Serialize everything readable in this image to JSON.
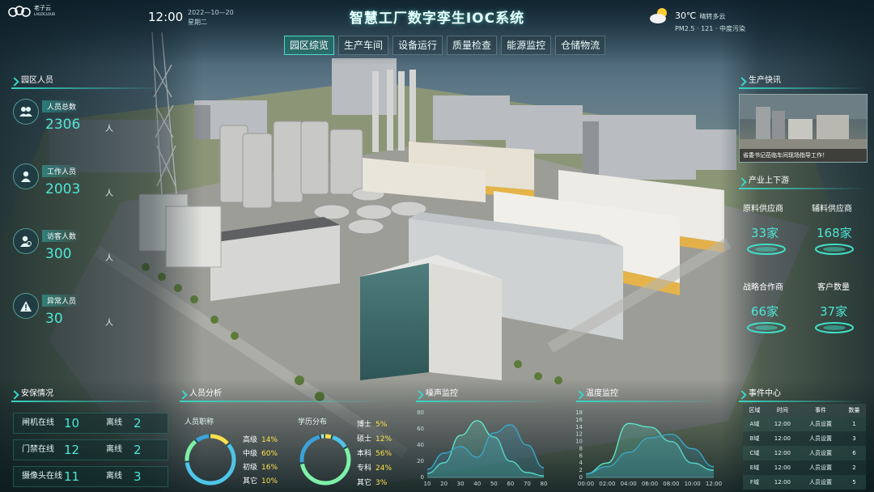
{
  "header": {
    "logo_text": "老子云",
    "logo_sub": "LAOZICLOUD",
    "time": "12:00",
    "date": "2022—10—20",
    "weekday": "星期二",
    "title": "智慧工厂数字孪生IOC系统",
    "weather": {
      "temp": "30℃",
      "desc": "晴转多云",
      "air": "PM2.5 · 121 · 中度污染",
      "icon": "partly-cloudy-icon"
    }
  },
  "nav": {
    "tabs": [
      "园区综览",
      "生产车间",
      "设备运行",
      "质量检查",
      "能源监控",
      "仓储物流"
    ],
    "active": 0
  },
  "personnel": {
    "title": "园区人员",
    "items": [
      {
        "label": "人员总数",
        "value": "2306",
        "unit": "人",
        "icon": "group-icon"
      },
      {
        "label": "工作人员",
        "value": "2003",
        "unit": "人",
        "icon": "worker-icon"
      },
      {
        "label": "访客人数",
        "value": "300",
        "unit": "人",
        "icon": "visitor-icon"
      },
      {
        "label": "异常人员",
        "value": "30",
        "unit": "人",
        "icon": "warning-icon"
      }
    ]
  },
  "security": {
    "title": "安保情况",
    "rows": [
      {
        "online_label": "闸机在线",
        "online": "10",
        "offline_label": "离线",
        "offline": "2"
      },
      {
        "online_label": "门禁在线",
        "online": "12",
        "offline_label": "离线",
        "offline": "2"
      },
      {
        "online_label": "摄像头在线",
        "online": "11",
        "offline_label": "离线",
        "offline": "3"
      }
    ]
  },
  "analysis": {
    "title": "人员分析",
    "rank_title": "人员职称",
    "rank": [
      {
        "name": "高级",
        "pct": "14%"
      },
      {
        "name": "中级",
        "pct": "60%"
      },
      {
        "name": "初级",
        "pct": "16%"
      },
      {
        "name": "其它",
        "pct": "10%"
      }
    ],
    "edu_title": "学历分布",
    "edu": [
      {
        "name": "博士",
        "pct": "5%"
      },
      {
        "name": "硕士",
        "pct": "12%"
      },
      {
        "name": "本科",
        "pct": "56%"
      },
      {
        "name": "专科",
        "pct": "24%"
      },
      {
        "name": "其它",
        "pct": "3%"
      }
    ]
  },
  "noise": {
    "title": "噪声监控",
    "chart_data": {
      "type": "area",
      "x": [
        10,
        20,
        30,
        40,
        50,
        60,
        70,
        80
      ],
      "ylim": [
        0,
        80
      ],
      "yticks": [
        0,
        20,
        40,
        60,
        80
      ],
      "series": [
        {
          "values": [
            5,
            18,
            52,
            70,
            50,
            20,
            6,
            2
          ]
        },
        {
          "values": [
            10,
            30,
            38,
            25,
            55,
            65,
            40,
            12
          ]
        }
      ]
    }
  },
  "temperature": {
    "title": "温度监控",
    "chart_data": {
      "type": "area",
      "x": [
        "00:00",
        "02:00",
        "04:00",
        "06:00",
        "08:00",
        "10:00",
        "12:00"
      ],
      "ylim": [
        0,
        18
      ],
      "yticks": [
        0,
        2,
        4,
        6,
        8,
        10,
        12,
        14,
        16,
        18
      ],
      "series": [
        {
          "values": [
            1,
            4,
            15,
            14,
            10,
            4,
            2
          ]
        },
        {
          "values": [
            1,
            3,
            7,
            11,
            12,
            8,
            3
          ]
        }
      ]
    }
  },
  "news": {
    "title": "生产快讯",
    "caption": "省委书记莅临车间现场指导工作！"
  },
  "chain": {
    "title": "产业上下游",
    "items": [
      {
        "label": "原料供应商",
        "value": "33家"
      },
      {
        "label": "辅料供应商",
        "value": "168家"
      },
      {
        "label": "战略合作商",
        "value": "66家"
      },
      {
        "label": "客户数量",
        "value": "37家"
      }
    ]
  },
  "events": {
    "title": "事件中心",
    "headers": [
      "区域",
      "时间",
      "事件",
      "数量"
    ],
    "rows": [
      [
        "A域",
        "12:00",
        "人员设置",
        "1"
      ],
      [
        "B域",
        "12:00",
        "人员设置",
        "3"
      ],
      [
        "C域",
        "12:00",
        "人员设置",
        "6"
      ],
      [
        "E域",
        "12:00",
        "人员设置",
        "2"
      ],
      [
        "F域",
        "12:00",
        "人员设置",
        "5"
      ]
    ]
  },
  "colors": {
    "accent": "#4ee6d6",
    "highlight": "#ffe14d",
    "line1": "#5fe3c8",
    "line2": "#3aa6c9"
  }
}
